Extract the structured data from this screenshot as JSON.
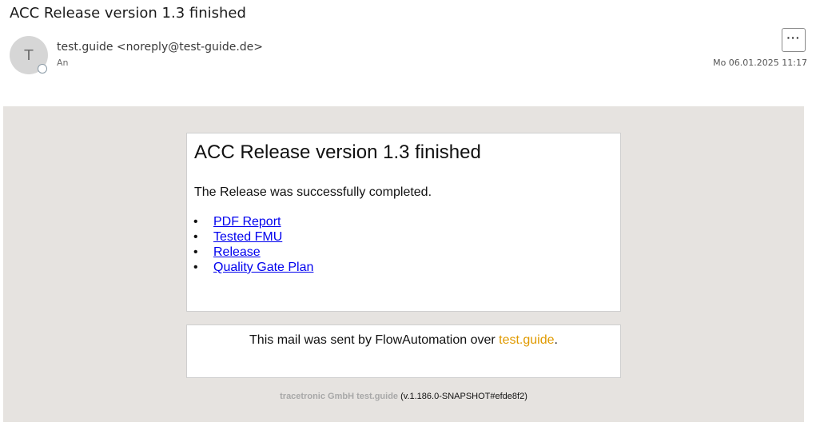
{
  "header": {
    "subject": "ACC Release version 1.3 finished",
    "avatar_initial": "T",
    "sender": "test.guide <noreply@test-guide.de>",
    "to_label": "An",
    "date": "Mo 06.01.2025 11:17",
    "more_label": "···"
  },
  "content": {
    "title": "ACC Release version 1.3 finished",
    "text": "The Release was successfully completed.",
    "links": [
      {
        "label": "PDF Report"
      },
      {
        "label": "Tested FMU"
      },
      {
        "label": "Release"
      },
      {
        "label": "Quality Gate Plan"
      }
    ]
  },
  "footer": {
    "text_before": "This mail was sent by FlowAutomation over ",
    "link_label": "test.guide",
    "text_after": "."
  },
  "signature": {
    "company": "tracetronic GmbH test.guide",
    "version": "(v.1.186.0-SNAPSHOT#efde8f2)"
  },
  "colors": {
    "body_background": "#e6e3e0",
    "link": "#0000ee",
    "footer_link": "#e09a00"
  }
}
